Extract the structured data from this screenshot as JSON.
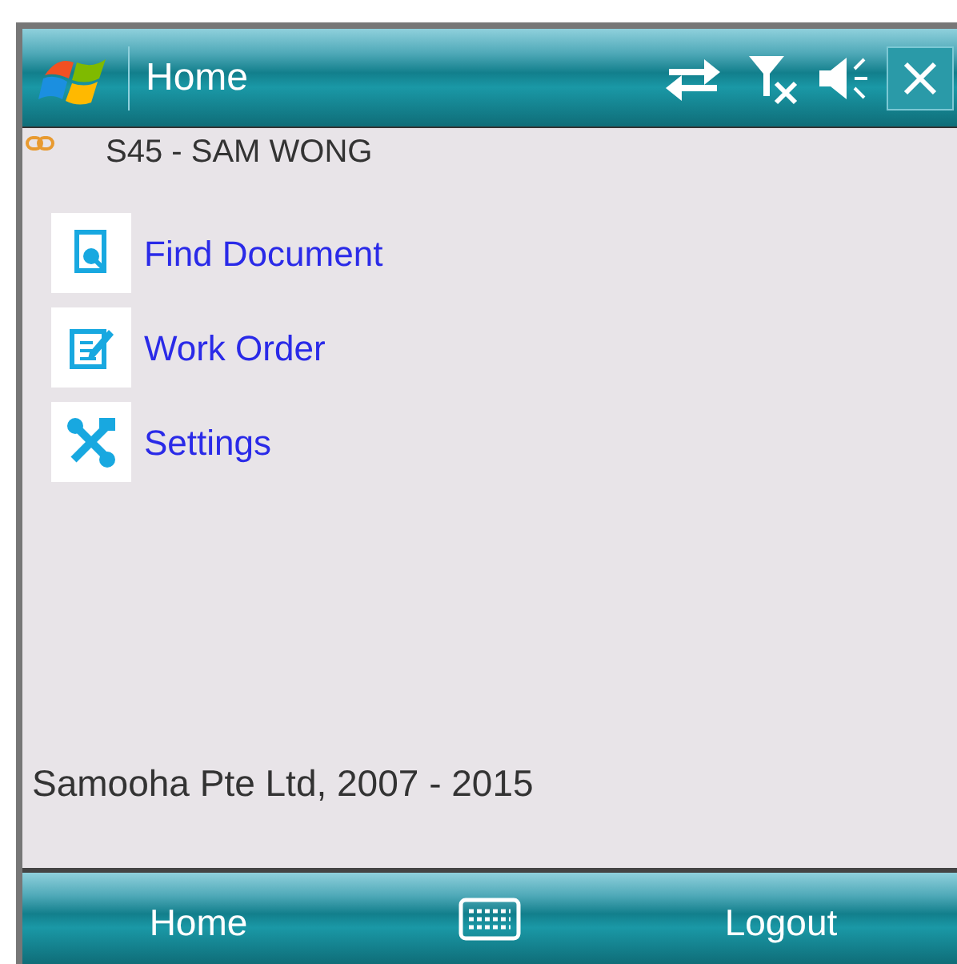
{
  "title_bar": {
    "title": "Home"
  },
  "user": {
    "label": "S45 - SAM WONG"
  },
  "menu": [
    {
      "kind": "find",
      "label": "Find Document"
    },
    {
      "kind": "edit",
      "label": "Work Order"
    },
    {
      "kind": "tools",
      "label": "Settings"
    }
  ],
  "footer_text": "Samooha Pte Ltd, 2007 - 2015",
  "soft_keys": {
    "left": "Home",
    "right": "Logout"
  }
}
